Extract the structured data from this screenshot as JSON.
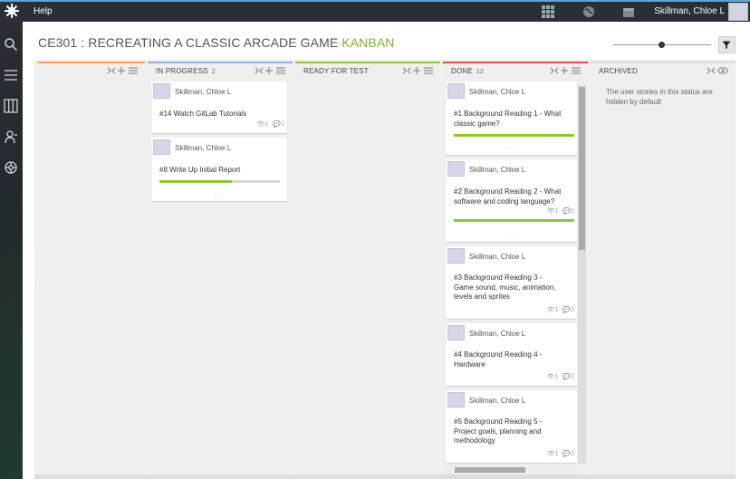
{
  "topbar": {
    "help": "Help",
    "user_name": "Skillman, Chloe L"
  },
  "header": {
    "project": "CE301 : RECREATING A CLASSIC ARCADE GAME",
    "section": "KANBAN"
  },
  "columns": [
    {
      "key": "new",
      "title": "",
      "count": "",
      "color": "#f0a35e"
    },
    {
      "key": "in_progress",
      "title": "IN PROGRESS",
      "count": "2",
      "color": "#8fb3e0"
    },
    {
      "key": "ready_for_test",
      "title": "READY FOR TEST",
      "count": "",
      "color": "#8cc63f"
    },
    {
      "key": "done",
      "title": "DONE",
      "count": "12",
      "color": "#e05050"
    },
    {
      "key": "archived",
      "title": "ARCHIVED",
      "count": "",
      "color": "#dddddd"
    }
  ],
  "cards": {
    "in_progress": [
      {
        "owner": "Skillman, Chloe L",
        "title": "#14 Watch GitLab Tutorials",
        "watchers": "1",
        "comments": "1",
        "progress": null
      },
      {
        "owner": "Skillman, Chloe L",
        "title": "#8 Write Up Initial Report",
        "watchers": "",
        "comments": "",
        "progress": 0.6
      }
    ],
    "done": [
      {
        "owner": "Skillman, Chloe L",
        "title_l1": "#1 Background Reading 1 - What",
        "title_l2": "classic game?",
        "title_l3": "",
        "watchers": "",
        "comments": "",
        "progress": 1.0
      },
      {
        "owner": "Skillman, Chloe L",
        "title_l1": "#2 Background Reading 2 - What",
        "title_l2": "software and coding language?",
        "title_l3": "",
        "watchers": "1",
        "comments": "1",
        "progress": 1.0
      },
      {
        "owner": "Skillman, Chloe L",
        "title_l1": "#3 Background Reading 3 -",
        "title_l2": "Game sound, music, animation,",
        "title_l3": "levels and sprites",
        "watchers": "1",
        "comments": "2",
        "progress": null
      },
      {
        "owner": "Skillman, Chloe L",
        "title_l1": "#4 Background Reading 4 -",
        "title_l2": "Hardware",
        "title_l3": "",
        "watchers": "1",
        "comments": "1",
        "progress": null
      },
      {
        "owner": "Skillman, Chloe L",
        "title_l1": "#5 Background Reading 5 -",
        "title_l2": "Project goals, planning and",
        "title_l3": "methodology",
        "watchers": "1",
        "comments": "2",
        "progress": null
      }
    ]
  },
  "archived_note_l1": "The user stories in this status are",
  "archived_note_l2": "hidden by default",
  "icons": {
    "top": [
      "logo-icon",
      "grid-icon",
      "globe-icon",
      "calendar-icon"
    ],
    "sidebar": [
      "search-icon",
      "backlog-icon",
      "kanban-icon",
      "team-icon",
      "settings-icon"
    ]
  },
  "colors": {
    "accent_green": "#83b131",
    "progress_green": "#8cc63f",
    "topbar_bg": "#2b2f35"
  }
}
